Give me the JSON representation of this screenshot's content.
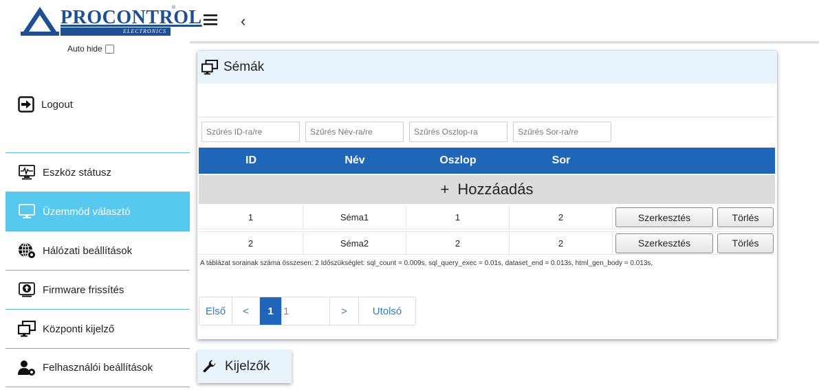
{
  "app": {
    "logo_text": "PROCONTROL",
    "logo_sub": "ELECTRONICS",
    "logo_reg": "®",
    "auto_hide_label": "Auto hide"
  },
  "sidebar": {
    "logout_label": "Logout",
    "items": [
      {
        "label": "Eszköz státusz",
        "icon": "pulse-monitor-icon",
        "active": false
      },
      {
        "label": "Üzemmód választó",
        "icon": "monitor-icon",
        "active": true
      },
      {
        "label": "Hálózati beállítások",
        "icon": "globe-gear-icon",
        "active": false
      },
      {
        "label": "Firmware frissítés",
        "icon": "upload-box-icon",
        "active": false
      },
      {
        "label": "Központi kijelző",
        "icon": "dual-monitor-icon",
        "active": false
      },
      {
        "label": "Felhasználói beállítások",
        "icon": "user-gear-icon",
        "active": false
      }
    ]
  },
  "topbar": {
    "back_glyph": "‹"
  },
  "panel": {
    "title": "Sémák",
    "filters": [
      "Szűrés ID-ra/re",
      "Szűrés Név-ra/re",
      "Szűrés Oszlop-ra",
      "Szűrés Sor-ra/re"
    ],
    "columns": [
      "ID",
      "Név",
      "Oszlop",
      "Sor"
    ],
    "add_label": "Hozzáadás",
    "add_glyph": "+",
    "rows": [
      {
        "id": "1",
        "nev": "Séma1",
        "oszlop": "1",
        "sor": "2"
      },
      {
        "id": "2",
        "nev": "Séma2",
        "oszlop": "2",
        "sor": "2"
      }
    ],
    "edit_label": "Szerkesztés",
    "delete_label": "Törlés",
    "footer_info": "A táblázat sorainak száma összesen: 2   Időszükséglet: sql_count = 0.009s, sql_query_exec = 0.01s, dataset_end = 0.013s, html_gen_body = 0.013s,",
    "pager": {
      "first": "Első",
      "prev": "<",
      "current": "1",
      "input_value": "1",
      "next": ">",
      "last": "Utolsó"
    }
  },
  "kijelzok": {
    "label": "Kijelzők"
  },
  "colors": {
    "accent": "#1f66b8",
    "active": "#57c9ee",
    "panel_head": "#e9f3fb"
  }
}
